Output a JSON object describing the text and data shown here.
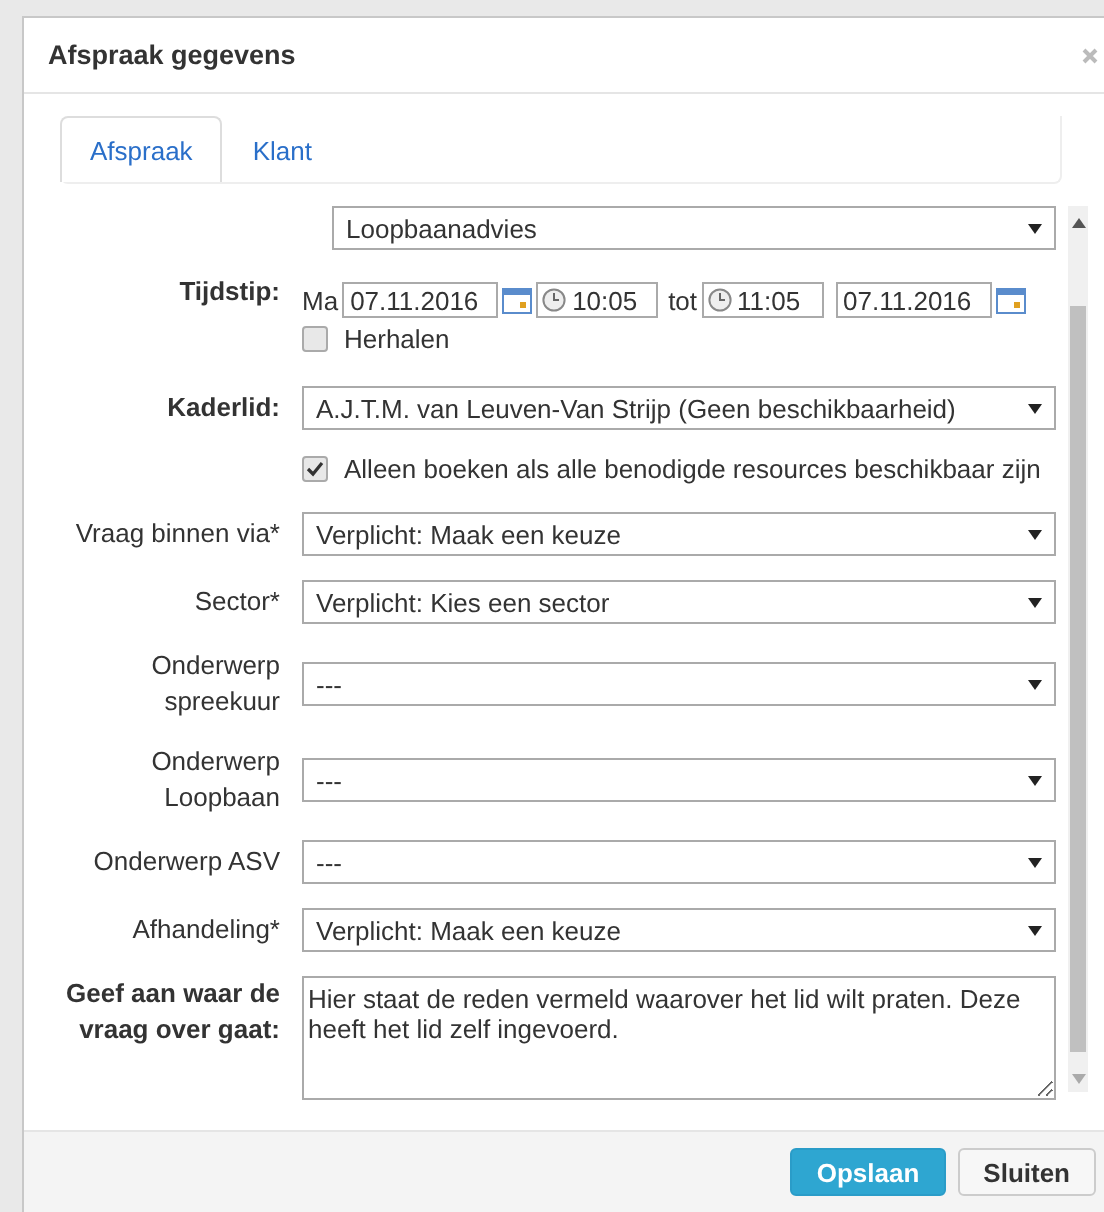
{
  "dialog": {
    "title": "Afspraak gegevens"
  },
  "tabs": [
    {
      "label": "Afspraak",
      "selected": true
    },
    {
      "label": "Klant",
      "selected": false
    }
  ],
  "fields": [
    {
      "kind": "select",
      "value": "Loopbaanadvies"
    },
    {
      "kind": "datetime",
      "label": "Tijdstip:",
      "bold": true,
      "day": "Ma",
      "start_date": "07.11.2016",
      "start_time": "10:05",
      "separator": "tot",
      "end_time": "11:05",
      "end_date": "07.11.2016",
      "repeat": {
        "label": "Herhalen",
        "checked": false
      }
    },
    {
      "kind": "select",
      "label": "Kaderlid:",
      "bold": true,
      "value": "A.J.T.M. van Leuven-Van Strijp (Geen beschikbaarheid)"
    },
    {
      "kind": "checkbox",
      "text": "Alleen boeken als alle benodigde resources beschikbaar zijn",
      "checked": true
    },
    {
      "kind": "select",
      "label": "Vraag binnen via*",
      "bold": false,
      "value": "Verplicht: Maak een keuze"
    },
    {
      "kind": "select",
      "label": "Sector*",
      "bold": false,
      "value": "Verplicht: Kies een sector"
    },
    {
      "kind": "select",
      "label": "Onderwerp spreekuur",
      "bold": false,
      "value": "---"
    },
    {
      "kind": "select",
      "label": "Onderwerp Loopbaan",
      "bold": false,
      "value": "---"
    },
    {
      "kind": "select",
      "label": "Onderwerp ASV",
      "bold": false,
      "value": "---"
    },
    {
      "kind": "select",
      "label": "Afhandeling*",
      "bold": false,
      "value": "Verplicht: Maak een keuze"
    },
    {
      "kind": "textarea",
      "label": "Geef aan waar de vraag over gaat:",
      "bold": true,
      "value": "Hier staat de reden vermeld waarover het lid wilt praten. Deze heeft het lid zelf ingevoerd."
    }
  ],
  "buttons": [
    {
      "label": "Opslaan",
      "primary": true
    },
    {
      "label": "Sluiten",
      "primary": false
    }
  ]
}
